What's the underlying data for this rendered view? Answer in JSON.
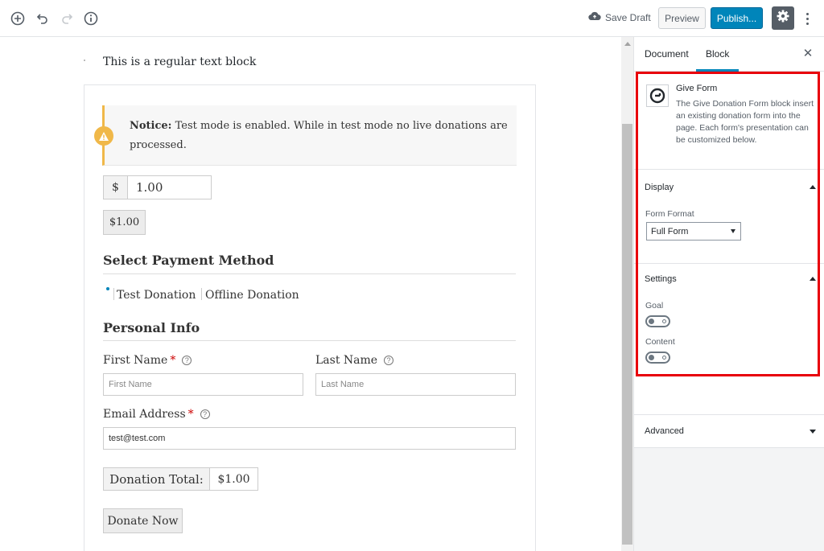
{
  "toolbar": {
    "save_draft_label": "Save Draft",
    "preview_label": "Preview",
    "publish_label": "Publish..."
  },
  "editor": {
    "paragraph_text": "This is a regular text block",
    "notice": {
      "strong": "Notice:",
      "text": " Test mode is enabled. While in test mode no live donations are processed."
    },
    "amount": {
      "currency_symbol": "$",
      "value": "1.00"
    },
    "level_button": "$1.00",
    "payment_section_title": "Select Payment Method",
    "gateways": [
      "Test Donation",
      "Offline Donation"
    ],
    "personal_section_title": "Personal Info",
    "first_name": {
      "label": "First Name",
      "required_mark": "*",
      "placeholder": "First Name"
    },
    "last_name": {
      "label": "Last Name",
      "placeholder": "Last Name"
    },
    "email": {
      "label": "Email Address",
      "required_mark": "*",
      "value": "test@test.com"
    },
    "help_glyph": "?",
    "donation_total": {
      "label": "Donation Total:",
      "value": "$1.00"
    },
    "donate_button": "Donate Now"
  },
  "sidebar": {
    "tabs": [
      "Document",
      "Block"
    ],
    "active_tab": "Block",
    "close_glyph": "✕",
    "block": {
      "title": "Give Form",
      "description": "The Give Donation Form block insert an existing donation form into the page. Each form's presentation can be customized below."
    },
    "display_panel": {
      "title": "Display",
      "form_format_label": "Form Format",
      "form_format_value": "Full Form"
    },
    "settings_panel": {
      "title": "Settings",
      "goal_label": "Goal",
      "goal_enabled": false,
      "content_label": "Content",
      "content_enabled": false
    },
    "advanced_panel": {
      "title": "Advanced"
    }
  },
  "colors": {
    "publish_blue": "#0085ba",
    "notice_accent": "#f0b849",
    "highlight_red": "#e8000b",
    "settings_button": "#555d66"
  },
  "icons": [
    "add-block-icon",
    "undo-icon",
    "redo-icon",
    "info-icon",
    "cloud-upload-icon",
    "gear-icon",
    "more-vertical-icon",
    "warning-icon",
    "give-logo-icon",
    "close-icon",
    "help-icon"
  ]
}
